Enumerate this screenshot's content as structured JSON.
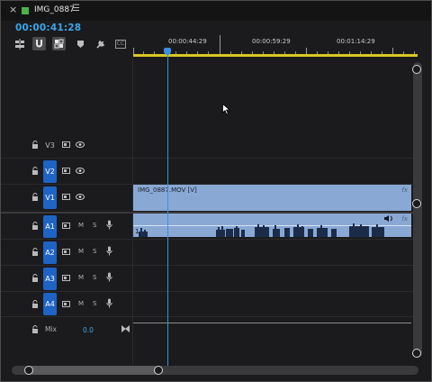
{
  "tab": {
    "close": "×",
    "title": "IMG_0887",
    "menu": "☰",
    "color": "#49b449"
  },
  "timecode": "00:00:41:28",
  "toolbar": {
    "tools": [
      "insert-nest-icon",
      "snap-icon",
      "linked-selection-icon",
      "marker-icon",
      "wrench-icon",
      "captions-icon"
    ],
    "captions_label": "CC"
  },
  "ruler": {
    "labels": [
      "00:00:44:29",
      "00:00:59:29",
      "00:01:14:29"
    ],
    "workarea_color": "#d9c624",
    "playhead_color": "#3a8fe0"
  },
  "tracks": {
    "video": [
      {
        "name": "V3",
        "targeted": false
      },
      {
        "name": "V2",
        "targeted": true
      },
      {
        "name": "V1",
        "targeted": true
      }
    ],
    "audio": [
      {
        "name": "A1",
        "m": "M",
        "s": "S"
      },
      {
        "name": "A2",
        "m": "M",
        "s": "S"
      },
      {
        "name": "A3",
        "m": "M",
        "s": "S"
      },
      {
        "name": "A4",
        "m": "M",
        "s": "S"
      }
    ],
    "mix": {
      "label": "Mix",
      "value": "0.0"
    }
  },
  "clips": {
    "video_label": "IMG_0887.MOV [V]",
    "fx": "fx",
    "audio_channel": "1",
    "clip_color": "#89a8d4"
  }
}
